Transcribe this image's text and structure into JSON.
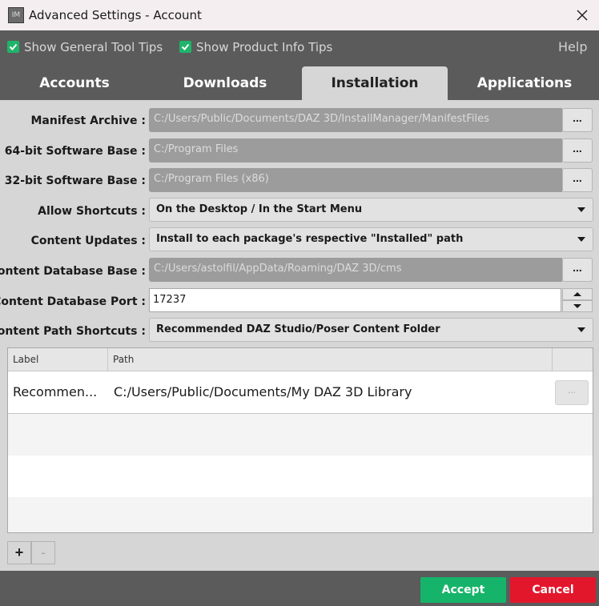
{
  "window": {
    "title": "Advanced Settings - Account",
    "app_icon_text": "IM"
  },
  "options": {
    "show_general_tool_tips": "Show General Tool Tips",
    "show_product_info_tips": "Show Product Info Tips",
    "help": "Help"
  },
  "tabs": [
    {
      "label": "Accounts",
      "active": false
    },
    {
      "label": "Downloads",
      "active": false
    },
    {
      "label": "Installation",
      "active": true
    },
    {
      "label": "Applications",
      "active": false
    }
  ],
  "fields": {
    "manifest_archive": {
      "label": "Manifest Archive :",
      "value": "C:/Users/Public/Documents/DAZ 3D/InstallManager/ManifestFiles"
    },
    "software_base_64": {
      "label": "64-bit Software Base :",
      "value": "C:/Program Files"
    },
    "software_base_32": {
      "label": "32-bit Software Base :",
      "value": "C:/Program Files (x86)"
    },
    "allow_shortcuts": {
      "label": "Allow Shortcuts :",
      "value": "On the Desktop / In the Start Menu"
    },
    "content_updates": {
      "label": "Content Updates :",
      "value": "Install to each package's respective \"Installed\" path"
    },
    "content_db_base": {
      "label": "Content Database Base :",
      "value": "C:/Users/astolfil/AppData/Roaming/DAZ 3D/cms"
    },
    "content_db_port": {
      "label": "Content Database Port :",
      "value": "17237"
    },
    "content_path_shortcuts": {
      "label": "Content Path Shortcuts :",
      "value": "Recommended DAZ Studio/Poser Content Folder"
    }
  },
  "browse_label": "...",
  "table": {
    "columns": [
      "Label",
      "Path"
    ],
    "rows": [
      {
        "label": "Recommen...",
        "path": "C:/Users/Public/Documents/My DAZ 3D Library",
        "button": "..."
      }
    ]
  },
  "add_label": "+",
  "remove_label": "-",
  "buttons": {
    "accept": "Accept",
    "cancel": "Cancel"
  },
  "colors": {
    "accept": "#16b46a",
    "cancel": "#e3172c",
    "checkbox": "#20b46a",
    "chrome": "#5b5b5b",
    "panel": "#d6d6d6"
  }
}
